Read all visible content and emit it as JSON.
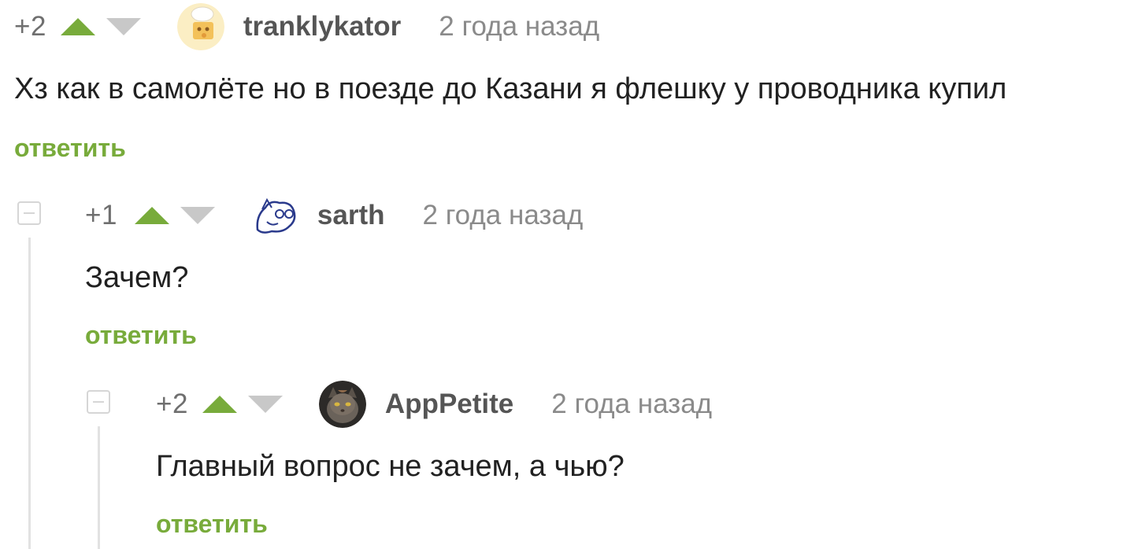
{
  "comments": [
    {
      "score": "+2",
      "username": "tranklykator",
      "time": "2 года назад",
      "text": "Хз как в самолёте но в поезде до Казани я флешку у проводника купил",
      "reply": "ответить",
      "avatar_icon": "cheese-chef-avatar"
    },
    {
      "score": "+1",
      "username": "sarth",
      "time": "2 года назад",
      "text": "Зачем?",
      "reply": "ответить",
      "avatar_icon": "doodle-creature-avatar"
    },
    {
      "score": "+2",
      "username": "AppPetite",
      "time": "2 года назад",
      "text": "Главный вопрос не зачем, а чью?",
      "reply": "ответить",
      "avatar_icon": "cat-photo-avatar"
    }
  ],
  "colors": {
    "accent_green": "#78ab3b",
    "downvote_gray": "#c8c8c8",
    "meta_gray": "#8a8a8a"
  }
}
